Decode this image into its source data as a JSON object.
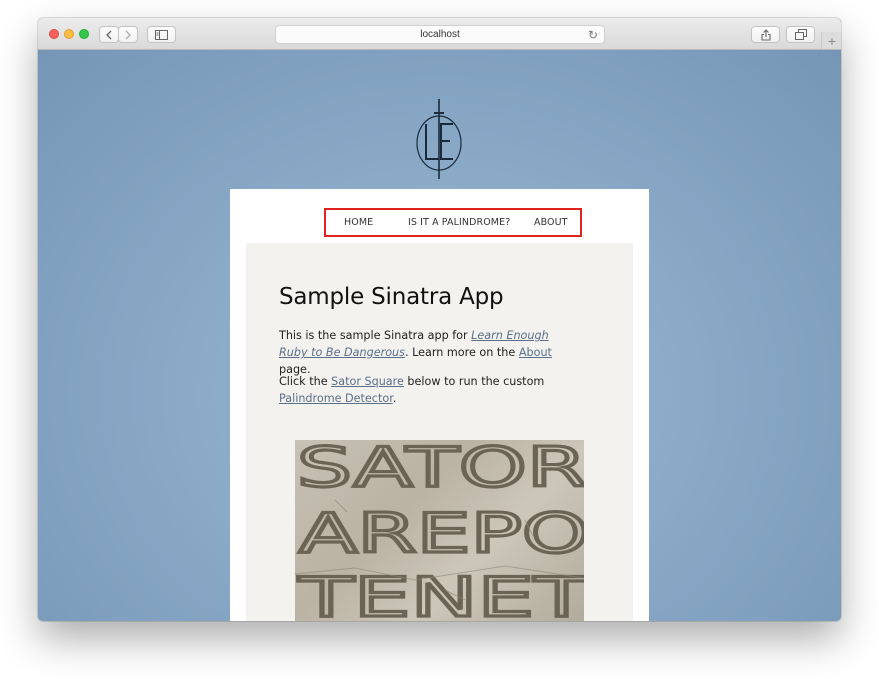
{
  "browser": {
    "url": "localhost",
    "reload_icon": "reload-icon",
    "nav_back_icon": "chevron-left-icon",
    "nav_forward_icon": "chevron-right-icon",
    "sidebar_icon": "sidebar-icon",
    "share_icon": "share-icon",
    "tabs_icon": "tabs-icon",
    "new_tab_label": "+"
  },
  "site": {
    "logo_text": "LE",
    "nav": {
      "home": "HOME",
      "palindrome": "IS IT A PALINDROME?",
      "about": "ABOUT"
    },
    "page_title": "Sample Sinatra App",
    "para1": {
      "prefix": "This is the sample Sinatra app for ",
      "link1": "Learn Enough Ruby to Be Dangerous",
      "middle": ". Learn more on the ",
      "link2": "About",
      "suffix": " page."
    },
    "para2": {
      "prefix": "Click the ",
      "link1": "Sator Square",
      "middle": " below to run the custom ",
      "link2": "Palindrome Detector",
      "suffix": "."
    },
    "image": {
      "row1": "SATOR",
      "row2": "AREPO",
      "row3": "TENET"
    }
  },
  "colors": {
    "page_background": "#8eadc8",
    "nav_highlight": "#e0231d",
    "link": "#5a6f8a"
  }
}
